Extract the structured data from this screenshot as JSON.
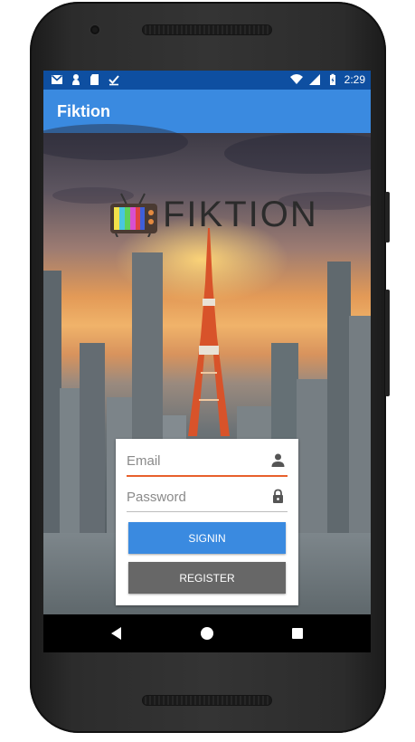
{
  "status_bar": {
    "time": "2:29",
    "left_icons": [
      "gmail-icon",
      "person-icon",
      "sd-card-icon",
      "download-done-icon"
    ],
    "right_icons": [
      "wifi-icon",
      "cellular-icon",
      "battery-charging-icon"
    ]
  },
  "app_bar": {
    "title": "Fiktion"
  },
  "logo": {
    "text": "FIKTION"
  },
  "login_form": {
    "email_placeholder": "Email",
    "password_placeholder": "Password",
    "signin_label": "SIGNIN",
    "register_label": "REGISTER"
  },
  "colors": {
    "status_bar": "#0e4fa1",
    "app_bar": "#3a8ae0",
    "signin_button": "#3a8ae0",
    "register_button": "#676767",
    "email_underline": "#e8602c"
  },
  "nav_bar": {
    "icons": [
      "back-icon",
      "home-icon",
      "recents-icon"
    ]
  }
}
